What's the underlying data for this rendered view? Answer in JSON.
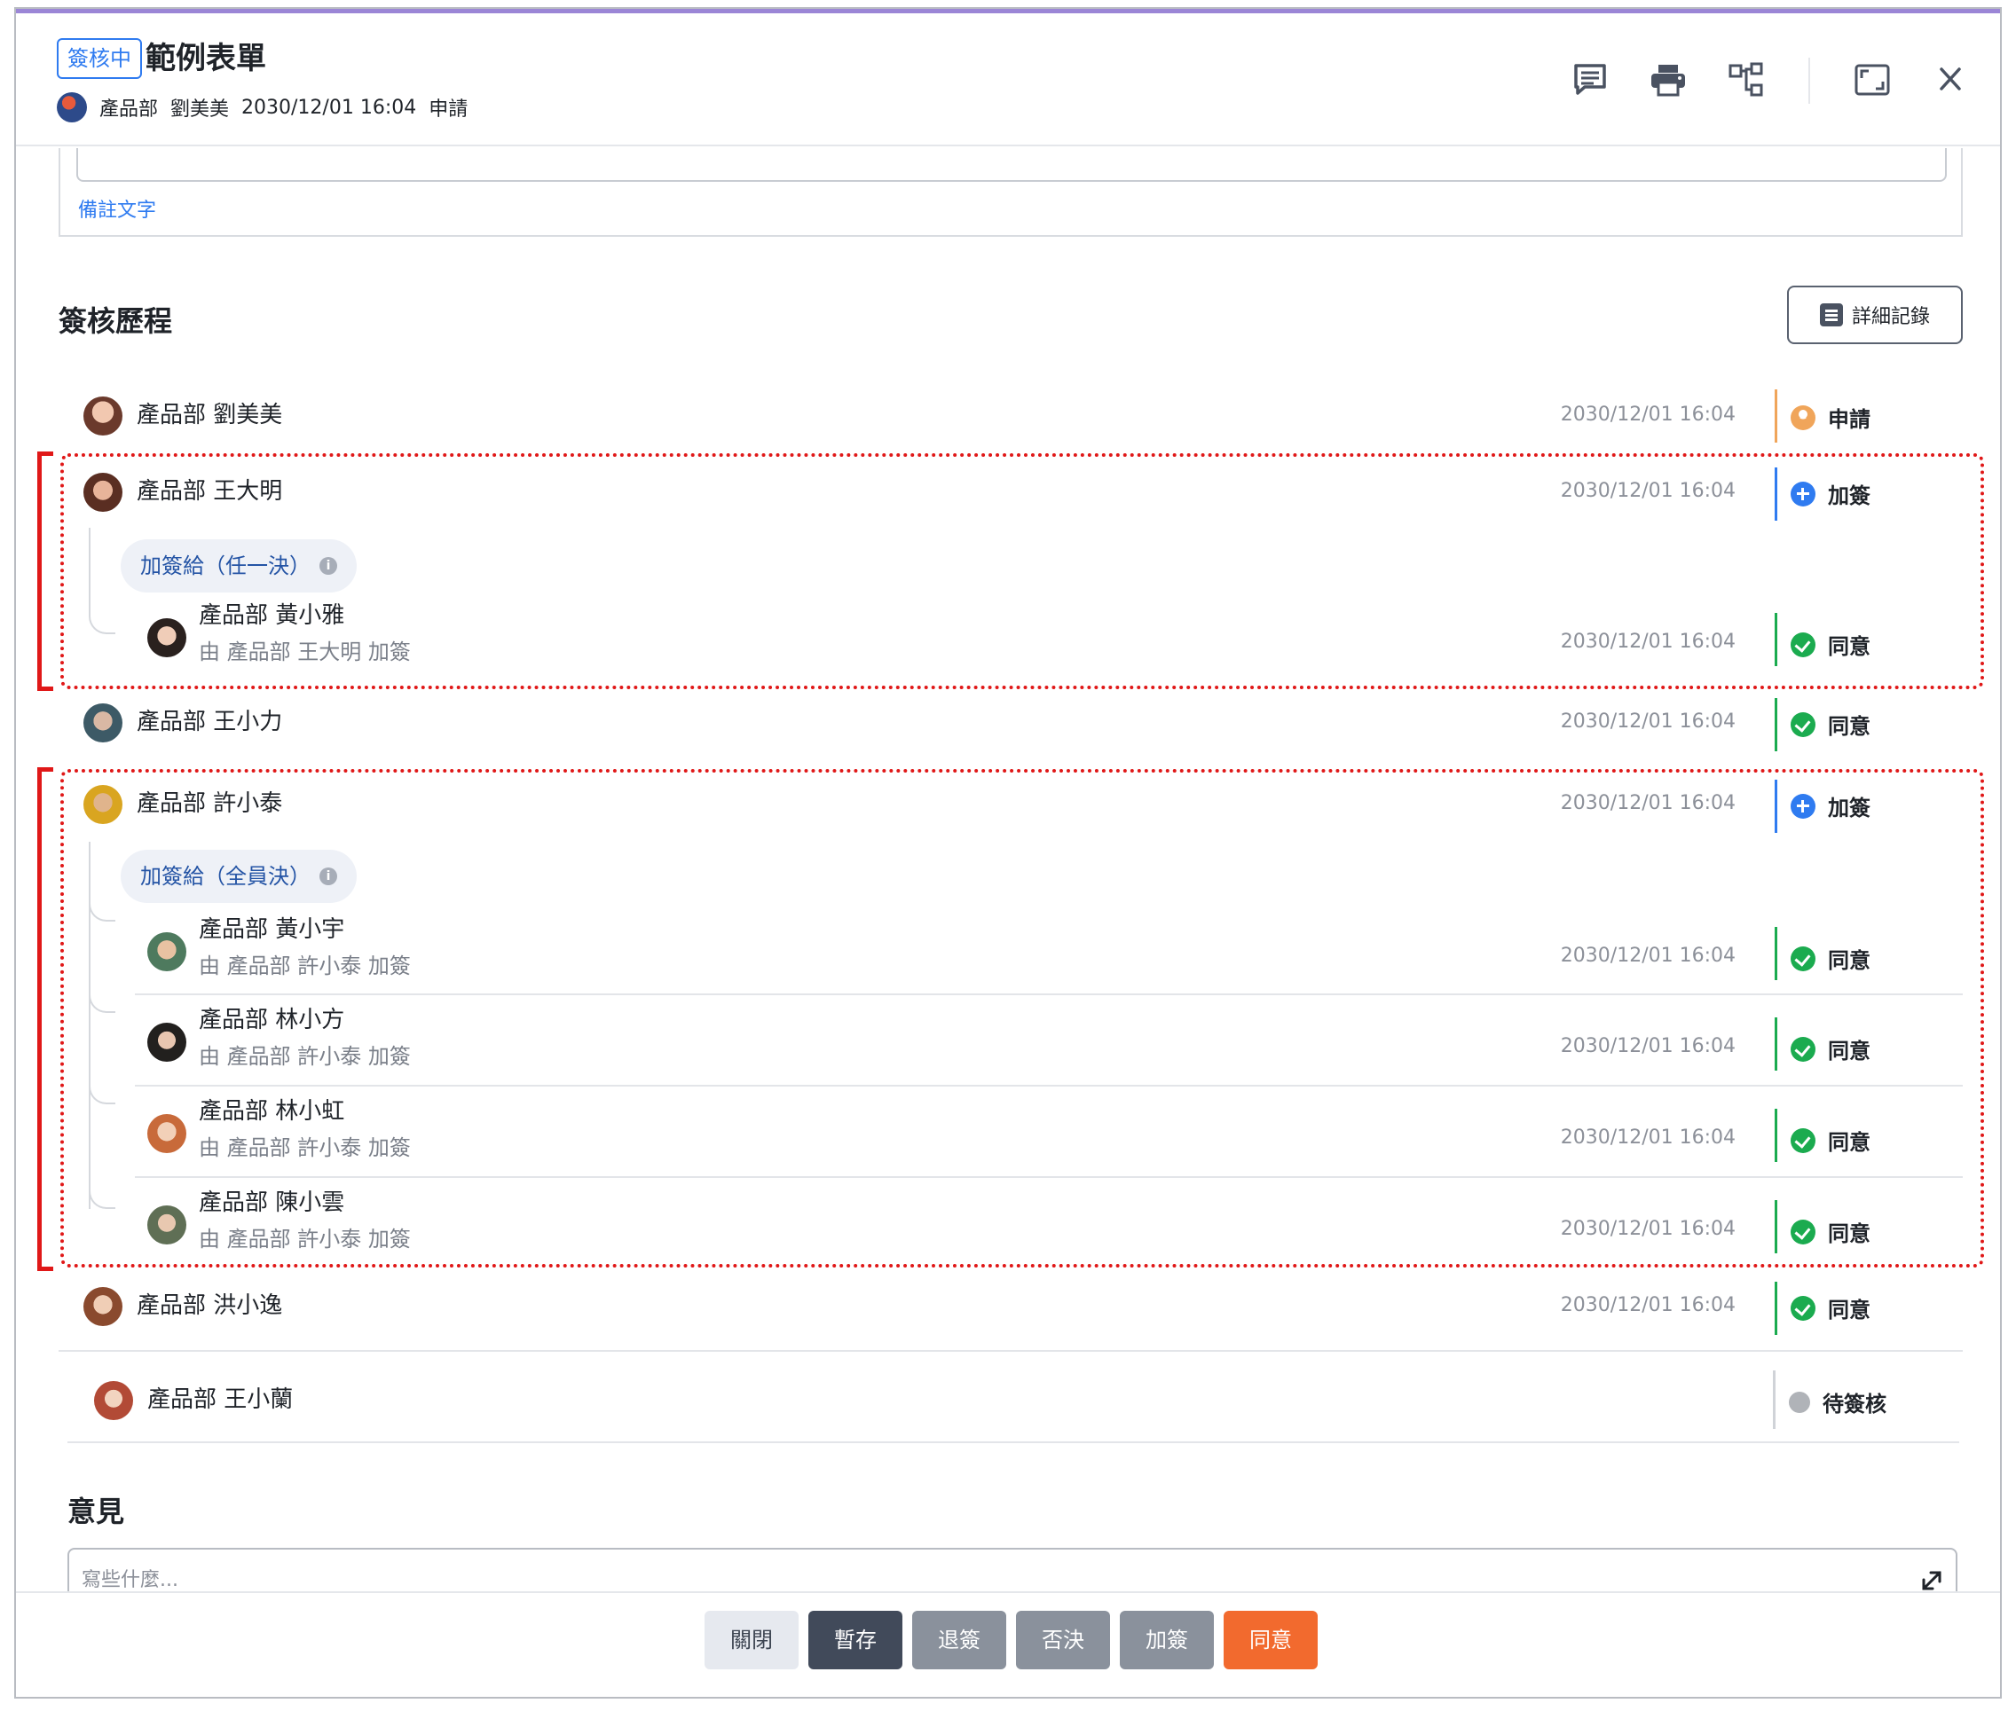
{
  "header": {
    "status_tag": "簽核中",
    "title": "範例表單",
    "applicant_dept": "產品部",
    "applicant_name": "劉美美",
    "applied_at": "2030/12/01 16:04",
    "applied_action": "申請"
  },
  "remark": {
    "label": "備註文字"
  },
  "history": {
    "title": "簽核歷程",
    "detail_button": "詳細記錄",
    "rows": [
      {
        "person": "產品部 劉美美",
        "time": "2030/12/01 16:04",
        "status": "申請"
      },
      {
        "person": "產品部 王大明",
        "time": "2030/12/01 16:04",
        "status": "加簽"
      },
      {
        "person": "產品部 王小力",
        "time": "2030/12/01 16:04",
        "status": "同意"
      },
      {
        "person": "產品部 許小泰",
        "time": "2030/12/01 16:04",
        "status": "加簽"
      },
      {
        "person": "產品部 洪小逸",
        "time": "2030/12/01 16:04",
        "status": "同意"
      },
      {
        "person": "產品部 王小蘭",
        "time": "",
        "status": "待簽核"
      }
    ],
    "group1": {
      "pill": "加簽給（任一決）",
      "children": [
        {
          "person": "產品部 黃小雅",
          "by": "由 產品部 王大明 加簽",
          "time": "2030/12/01 16:04",
          "status": "同意"
        }
      ]
    },
    "group2": {
      "pill": "加簽給（全員決）",
      "children": [
        {
          "person": "產品部 黃小宇",
          "by": "由 產品部 許小泰 加簽",
          "time": "2030/12/01 16:04",
          "status": "同意"
        },
        {
          "person": "產品部 林小方",
          "by": "由 產品部 許小泰 加簽",
          "time": "2030/12/01 16:04",
          "status": "同意"
        },
        {
          "person": "產品部 林小虹",
          "by": "由 產品部 許小泰 加簽",
          "time": "2030/12/01 16:04",
          "status": "同意"
        },
        {
          "person": "產品部 陳小雲",
          "by": "由 產品部 許小泰 加簽",
          "time": "2030/12/01 16:04",
          "status": "同意"
        }
      ]
    }
  },
  "opinion": {
    "title": "意見",
    "placeholder": "寫些什麼..."
  },
  "footer": {
    "buttons": [
      "關閉",
      "暫存",
      "退簽",
      "否決",
      "加簽",
      "同意"
    ]
  },
  "colors": {
    "primary": "#2f7bf0",
    "approve": "#1bab4f",
    "apply": "#f0a55a",
    "pending": "#b0b3b8",
    "highlight": "#e01818",
    "accept_button": "#f26a2e",
    "dark_button": "#414a5a",
    "gray_button": "#8a919c"
  },
  "icons": [
    "comment-icon",
    "print-icon",
    "flow-icon",
    "fullscreen-icon",
    "close-icon",
    "list-icon",
    "info-icon",
    "expand-icon"
  ]
}
